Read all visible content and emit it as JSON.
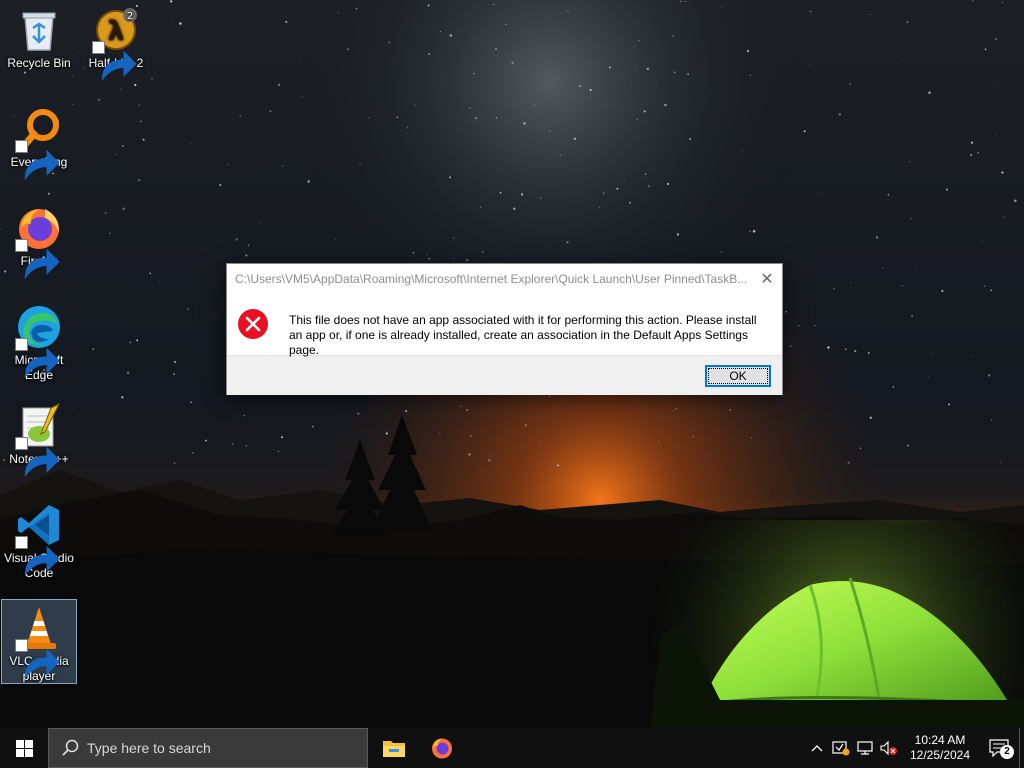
{
  "desktop": {
    "icons": [
      {
        "label": "Recycle Bin",
        "icon": "recycle-bin-icon"
      },
      {
        "label": "Half-Life 2",
        "icon": "half-life-2-icon"
      },
      {
        "label": "Everything",
        "icon": "everything-search-icon"
      },
      {
        "label": "Firefox",
        "icon": "firefox-icon"
      },
      {
        "label": "Microsoft Edge",
        "icon": "edge-icon"
      },
      {
        "label": "Notepad++",
        "icon": "notepad-plus-plus-icon"
      },
      {
        "label": "Visual Studio Code",
        "icon": "vscode-icon"
      },
      {
        "label": "VLC media player",
        "icon": "vlc-icon",
        "selected": true
      }
    ]
  },
  "dialog": {
    "title": "C:\\Users\\VM5\\AppData\\Roaming\\Microsoft\\Internet Explorer\\Quick Launch\\User Pinned\\TaskB...",
    "close_label": "✕",
    "message": "This file does not have an app associated with it for performing this action. Please install an app or, if one is already installed, create an association in the Default Apps Settings page.",
    "ok_label": "OK",
    "icon": "error-icon"
  },
  "taskbar": {
    "search_placeholder": "Type here to search",
    "pinned": [
      "file-explorer-icon",
      "firefox-icon"
    ],
    "tray_icons": [
      "chevron-up-icon",
      "security-icon",
      "network-icon",
      "volume-muted-icon"
    ],
    "clock_time": "10:24 AM",
    "clock_date": "12/25/2024",
    "notification_count": "2"
  },
  "colors": {
    "accent": "#0078d7",
    "error_red": "#e81123",
    "taskbar": "#101010",
    "tent_green": "#8fe03a"
  }
}
